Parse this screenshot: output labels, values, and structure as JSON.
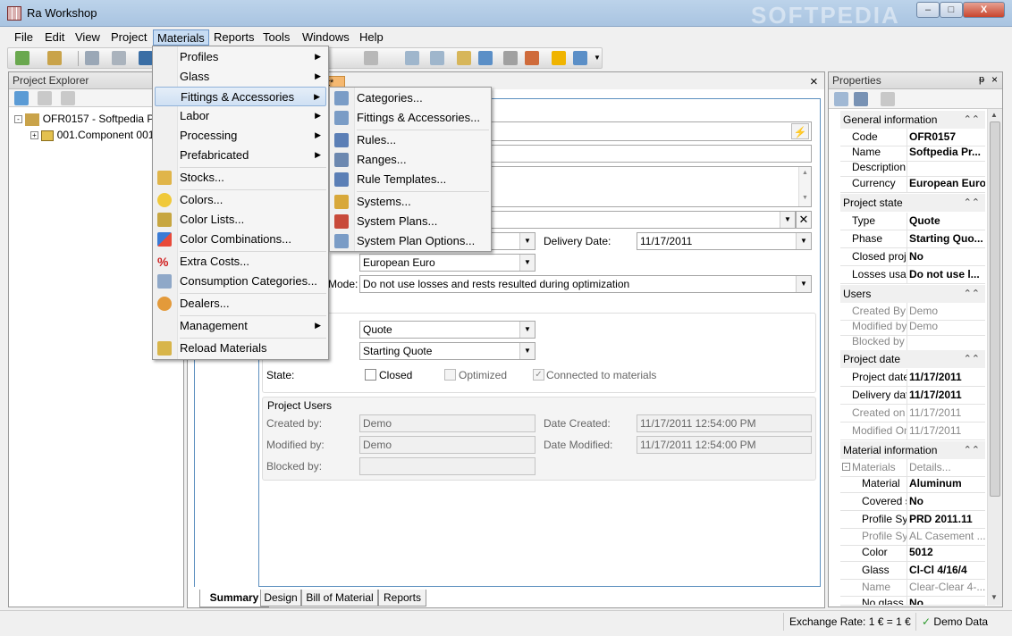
{
  "window": {
    "title": "Ra Workshop",
    "watermark": "SOFTPEDIA",
    "minimize": "–",
    "maximize": "□",
    "close": "X"
  },
  "menubar": [
    "File",
    "Edit",
    "View",
    "Project",
    "Materials",
    "Reports",
    "Tools",
    "Windows",
    "Help"
  ],
  "explorer": {
    "title": "Project Explorer",
    "root": "OFR0157 - Softpedia Pro",
    "child": "001.Component 001"
  },
  "document": {
    "tab_fragment": "t*",
    "close": "×",
    "delivery_date_label": "Delivery Date:",
    "delivery_date": "11/17/2011",
    "currency": "European Euro",
    "mode_label_fragment": "Mode:",
    "mode": "Do not use losses and rests resulted during optimization",
    "type": "Quote",
    "phase": "Starting Quote",
    "state_label": "State:",
    "state_closed": "Closed",
    "state_optimized": "Optimized",
    "state_connected": "Connected to materials",
    "users_group": "Project Users",
    "created_by_label": "Created by:",
    "created_by": "Demo",
    "modified_by_label": "Modified by:",
    "modified_by": "Demo",
    "blocked_by_label": "Blocked by:",
    "date_created_label": "Date Created:",
    "date_created": "11/17/2011 12:54:00 PM",
    "date_modified_label": "Date Modified:",
    "date_modified": "11/17/2011 12:54:00 PM",
    "tabs": [
      "Summary",
      "Design",
      "Bill of Material",
      "Reports"
    ]
  },
  "properties": {
    "title": "Properties",
    "categories": {
      "general": "General information",
      "state": "Project state",
      "users": "Users",
      "date": "Project date",
      "material": "Material information"
    },
    "rows": {
      "code": [
        "Code",
        "OFR0157"
      ],
      "name": [
        "Name",
        "Softpedia Pr..."
      ],
      "description": [
        "Description",
        ""
      ],
      "currency": [
        "Currency",
        "European Euro"
      ],
      "type": [
        "Type",
        "Quote"
      ],
      "phase": [
        "Phase",
        "Starting Quo..."
      ],
      "closed": [
        "Closed proje",
        "No"
      ],
      "losses": [
        "Losses usag",
        "Do not use l..."
      ],
      "created_by": [
        "Created By",
        "Demo"
      ],
      "modified_by": [
        "Modified by",
        "Demo"
      ],
      "blocked_by": [
        "Blocked by",
        ""
      ],
      "project_date": [
        "Project date",
        "11/17/2011"
      ],
      "delivery_date": [
        "Delivery dat",
        "11/17/2011"
      ],
      "created_on": [
        "Created on",
        "11/17/2011"
      ],
      "modified_on": [
        "Modified On",
        "11/17/2011"
      ],
      "materials": [
        "Materials",
        "Details..."
      ],
      "material": [
        "Material",
        "Aluminum"
      ],
      "covered": [
        "Covered s",
        "No"
      ],
      "profile_sys": [
        "Profile Sys",
        "PRD 2011.11"
      ],
      "profile_sys2": [
        "Profile Sys",
        "AL Casement ..."
      ],
      "color": [
        "Color",
        "5012"
      ],
      "glass": [
        "Glass",
        "Cl-Cl 4/16/4"
      ],
      "glass_name": [
        "Name",
        "Clear-Clear 4-..."
      ],
      "no_glass": [
        "No glass",
        "No"
      ]
    }
  },
  "status": {
    "exchange": "Exchange Rate: 1 € = 1 €",
    "demo": "Demo Data"
  },
  "materials_menu": [
    {
      "label": "Profiles",
      "sub": true
    },
    {
      "label": "Glass",
      "sub": true
    },
    {
      "label": "Fittings & Accessories",
      "sub": true
    },
    {
      "label": "Labor",
      "sub": true
    },
    {
      "label": "Processing",
      "sub": true
    },
    {
      "label": "Prefabricated",
      "sub": true
    },
    {
      "label": "Stocks..."
    },
    {
      "label": "Colors..."
    },
    {
      "label": "Color Lists..."
    },
    {
      "label": "Color Combinations..."
    },
    {
      "label": "Extra Costs..."
    },
    {
      "label": "Consumption Categories..."
    },
    {
      "label": "Dealers..."
    },
    {
      "label": "Management",
      "sub": true
    },
    {
      "label": "Reload Materials"
    }
  ],
  "fittings_menu": [
    "Categories...",
    "Fittings & Accessories...",
    "Rules...",
    "Ranges...",
    "Rule Templates...",
    "Systems...",
    "System Plans...",
    "System Plan Options..."
  ],
  "colors": {
    "accent": "#5c8fbf",
    "highlight": "#cfe0f3"
  }
}
